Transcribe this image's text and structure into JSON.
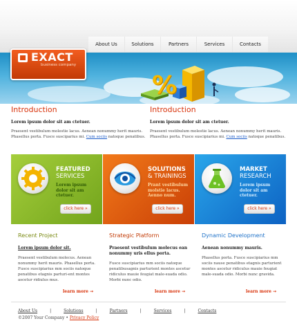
{
  "nav": {
    "items": [
      "About Us",
      "Solutions",
      "Partners",
      "Services",
      "Contacts"
    ]
  },
  "logo": {
    "name": "EXACT",
    "tagline": "business company"
  },
  "banner": {
    "percent_glyph": "%"
  },
  "intro": [
    {
      "title": "Introduction",
      "lead": "Lorem ipsum dolor sit am ctetuer.",
      "body_before_link": "Praesent vestibulum molestie lacus. Aenean nonummy herit mauris. Phasellus porta. Fusce susciparius mi. ",
      "link": "Cum sociis",
      "body_after_link": " natoque penatibus."
    },
    {
      "title": "Introduction",
      "lead": "Lorem ipsum dolor sit am ctetuer.",
      "body_before_link": "Praesent vestibulum molestie lacus. Aenean nonummy herit mauris. Phasellus porta. Fusce suscipiarius mi. ",
      "link": "Cum sociis",
      "body_after_link": " natoque penatibus."
    }
  ],
  "features": [
    {
      "title": "FEATURED",
      "subtitle": "SERVICES",
      "text": "Lorem ipsum dolor sit am ctetuer.",
      "button": "click here »",
      "icon": "gear-icon",
      "color": "#8aba2c"
    },
    {
      "title": "SOLUTIONS",
      "subtitle": "& TRAININGS",
      "text": "Prant vestibulum molstie lacus. Aenno num.",
      "button": "click here »",
      "icon": "eye-icon",
      "color": "#e05a10"
    },
    {
      "title": "MARKET",
      "subtitle": "RESEARCH",
      "text": "Lorem ipsum dolor sit am ctetuer.",
      "button": "click here »",
      "icon": "flask-icon",
      "color": "#1a86d8"
    }
  ],
  "columns": [
    {
      "title": "Recent Project",
      "lead": "Lorem ipsum dolor sit.",
      "body": "Praesent vestibulum molecus. Aenean nonummy herit mauris. Phasellus porta. Fusce suscipiarius mm sociis natoque penatibus etagnis parturi-ent montes ascetur ridiulus mus.",
      "learn": "learn more",
      "color": "#7a8a13"
    },
    {
      "title": "Strategic Platform",
      "lead": "Praesent vestibulum molecus ean nonummy uris ellus porta.",
      "body": "Fusce suscipiarius mm sociis natoque penatibusagnis parturient montes ascetur ridiculus mauie feugiat male-suada odio. Morbi nunc odio.",
      "learn": "learn more",
      "color": "#c23a05"
    },
    {
      "title": "Dynamic Development",
      "lead": "Aenean nonummy mauris.",
      "body": "Phasellus porta. Fusce suscipiarius mm sociis nause penatibus etagnis parturient montes ascetur ridiculus mauie feugiat male-suada odio. Morbi nunc gravida.",
      "learn": "learn more",
      "color": "#1f72c8"
    }
  ],
  "footer": {
    "links": [
      "About Us",
      "Solutions",
      "Partners",
      "Services",
      "Contacts"
    ],
    "copyright": "©2007 Your Company •",
    "privacy": "Privacy Policy"
  }
}
